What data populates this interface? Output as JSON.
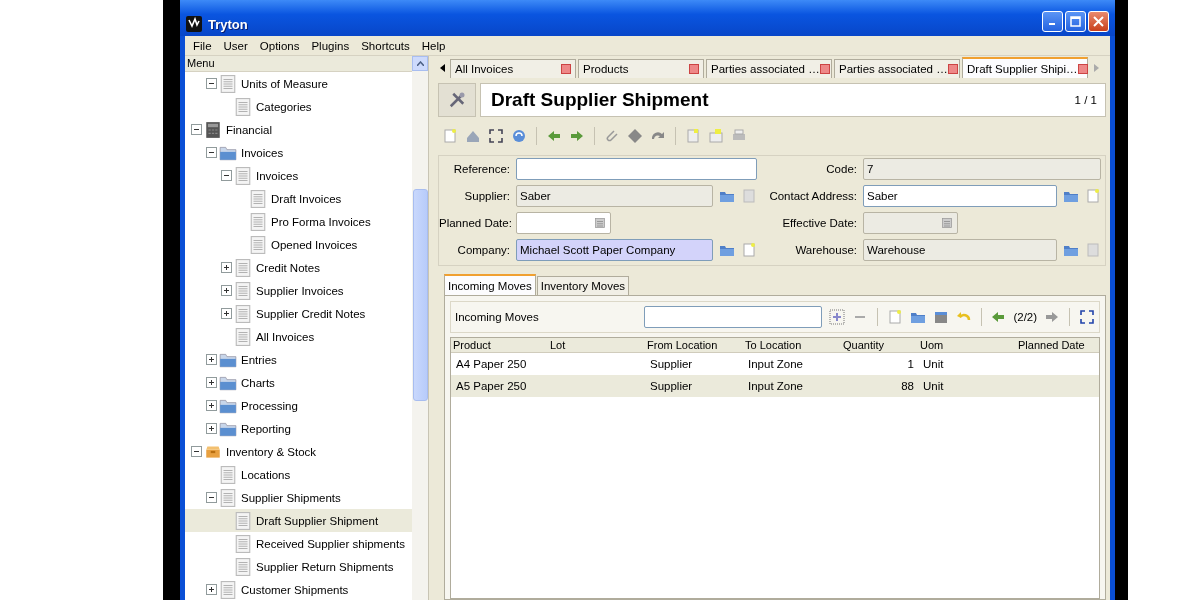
{
  "window": {
    "title": "Tryton"
  },
  "menu_bar": [
    "File",
    "User",
    "Options",
    "Plugins",
    "Shortcuts",
    "Help"
  ],
  "sidebar": {
    "title": "Menu",
    "items": [
      {
        "children": [
          {
            "label": "Units of Measure",
            "kind": "document",
            "expanded": true,
            "selected": false,
            "children": [
              {
                "label": "Categories",
                "kind": "document",
                "selected": false
              }
            ]
          }
        ]
      },
      {
        "label": "Financial",
        "kind": "cabinet",
        "expanded": true,
        "selected": false,
        "children": [
          {
            "label": "Invoices",
            "kind": "folder",
            "expanded": true,
            "selected": false,
            "children": [
              {
                "label": "Invoices",
                "kind": "document",
                "expanded": true,
                "selected": false,
                "children": [
                  {
                    "label": "Draft Invoices",
                    "kind": "document",
                    "selected": false
                  },
                  {
                    "label": "Pro Forma Invoices",
                    "kind": "document",
                    "selected": false
                  },
                  {
                    "label": "Opened Invoices",
                    "kind": "document",
                    "selected": false
                  }
                ]
              },
              {
                "label": "Credit Notes",
                "kind": "document",
                "expanded": false,
                "selected": false
              },
              {
                "label": "Supplier Invoices",
                "kind": "document",
                "expanded": false,
                "selected": false
              },
              {
                "label": "Supplier Credit Notes",
                "kind": "document",
                "expanded": false,
                "selected": false
              },
              {
                "label": "All Invoices",
                "kind": "document",
                "selected": false
              }
            ]
          },
          {
            "label": "Entries",
            "kind": "folder",
            "expanded": false,
            "selected": false
          },
          {
            "label": "Charts",
            "kind": "folder",
            "expanded": false,
            "selected": false
          },
          {
            "label": "Processing",
            "kind": "folder",
            "expanded": false,
            "selected": false
          },
          {
            "label": "Reporting",
            "kind": "folder",
            "expanded": false,
            "selected": false
          }
        ]
      },
      {
        "label": "Inventory & Stock",
        "kind": "box",
        "expanded": true,
        "selected": false,
        "children": [
          {
            "label": "Locations",
            "kind": "document",
            "selected": false
          },
          {
            "label": "Supplier Shipments",
            "kind": "document",
            "expanded": true,
            "selected": false,
            "children": [
              {
                "label": "Draft Supplier Shipment",
                "kind": "document",
                "selected": true
              },
              {
                "label": "Received Supplier shipments",
                "kind": "document",
                "selected": false
              },
              {
                "label": "Supplier Return Shipments",
                "kind": "document",
                "selected": false
              }
            ]
          },
          {
            "label": "Customer Shipments",
            "kind": "document",
            "expanded": false,
            "selected": false
          }
        ]
      }
    ]
  },
  "tabs": [
    {
      "label": "All Invoices",
      "selected": false
    },
    {
      "label": "Products",
      "selected": false
    },
    {
      "label": "Parties associated …",
      "selected": false
    },
    {
      "label": "Parties associated …",
      "selected": false
    },
    {
      "label": "Draft Supplier Shipi…",
      "selected": true
    }
  ],
  "header": {
    "title": "Draft Supplier Shipment",
    "counter": "1 / 1"
  },
  "fields": [
    {
      "label": "Reference:",
      "kind": "char",
      "readonly": false
    },
    {
      "label": "Code:",
      "value": "7",
      "kind": "char",
      "readonly": true
    },
    {
      "label": "Supplier:",
      "value": "Saber",
      "kind": "many2one",
      "readonly": true
    },
    {
      "label": "Contact Address:",
      "value": "Saber",
      "kind": "many2one",
      "readonly": false
    },
    {
      "label": "Planned Date:",
      "kind": "date",
      "readonly": false
    },
    {
      "label": "Effective Date:",
      "kind": "date",
      "readonly": true
    },
    {
      "label": "Company:",
      "value": "Michael Scott Paper Company",
      "kind": "many2one",
      "readonly": false,
      "focused": true
    },
    {
      "label": "Warehouse:",
      "value": "Warehouse",
      "kind": "many2one",
      "readonly": true
    }
  ],
  "notebook": {
    "tabs": [
      {
        "label": "Incoming Moves",
        "selected": true
      },
      {
        "label": "Inventory Moves",
        "selected": false
      }
    ],
    "toolbar": {
      "label": "Incoming Moves",
      "counter": "(2/2)"
    },
    "table": {
      "columns": [
        "Product",
        "Lot",
        "From Location",
        "To Location",
        "Quantity",
        "Uom",
        "Planned Date"
      ],
      "rows": [
        [
          "A4 Paper 250",
          null,
          "Supplier",
          "Input Zone",
          "1",
          "Unit",
          null
        ],
        [
          "A5 Paper 250",
          null,
          "Supplier",
          "Input Zone",
          "88",
          "Unit",
          null
        ]
      ]
    }
  }
}
